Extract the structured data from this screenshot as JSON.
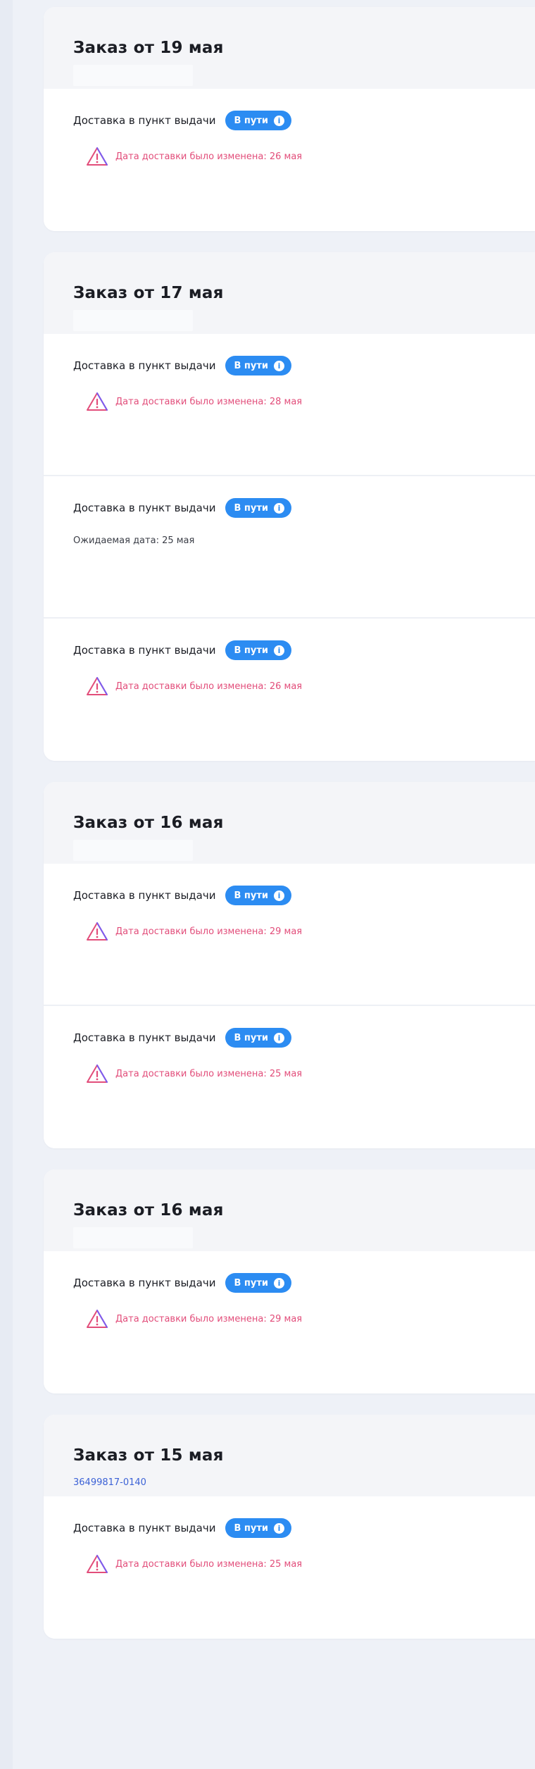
{
  "orders": [
    {
      "title": "Заказ от 19 мая",
      "number": "",
      "shipments": [
        {
          "type": "Доставка в пункт выдачи",
          "status": "В пути",
          "warning": "Дата доставки было изменена: 26 мая"
        }
      ]
    },
    {
      "title": "Заказ от 17 мая",
      "number": "",
      "shipments": [
        {
          "type": "Доставка в пункт выдачи",
          "status": "В пути",
          "warning": "Дата доставки было изменена: 28 мая"
        },
        {
          "type": "Доставка в пункт выдачи",
          "status": "В пути",
          "expected": "Ожидаемая дата: 25 мая"
        },
        {
          "type": "Доставка в пункт выдачи",
          "status": "В пути",
          "warning": "Дата доставки было изменена: 26 мая"
        }
      ]
    },
    {
      "title": "Заказ от 16 мая",
      "number": "",
      "shipments": [
        {
          "type": "Доставка в пункт выдачи",
          "status": "В пути",
          "warning": "Дата доставки было изменена: 29 мая"
        },
        {
          "type": "Доставка в пункт выдачи",
          "status": "В пути",
          "warning": "Дата доставки было изменена: 25 мая"
        }
      ]
    },
    {
      "title": "Заказ от 16 мая",
      "number": "",
      "shipments": [
        {
          "type": "Доставка в пункт выдачи",
          "status": "В пути",
          "warning": "Дата доставки было изменена: 29 мая"
        }
      ]
    },
    {
      "title": "Заказ от 15 мая",
      "number": "36499817-0140",
      "shipments": [
        {
          "type": "Доставка в пункт выдачи",
          "status": "В пути",
          "warning": "Дата доставки было изменена: 25 мая"
        }
      ]
    }
  ],
  "colors": {
    "badge": "#2c8cf2",
    "warning": "#e24d7a",
    "link": "#3c62d6"
  },
  "icons": {
    "warning": "warning-triangle-icon",
    "info": "info-icon"
  }
}
